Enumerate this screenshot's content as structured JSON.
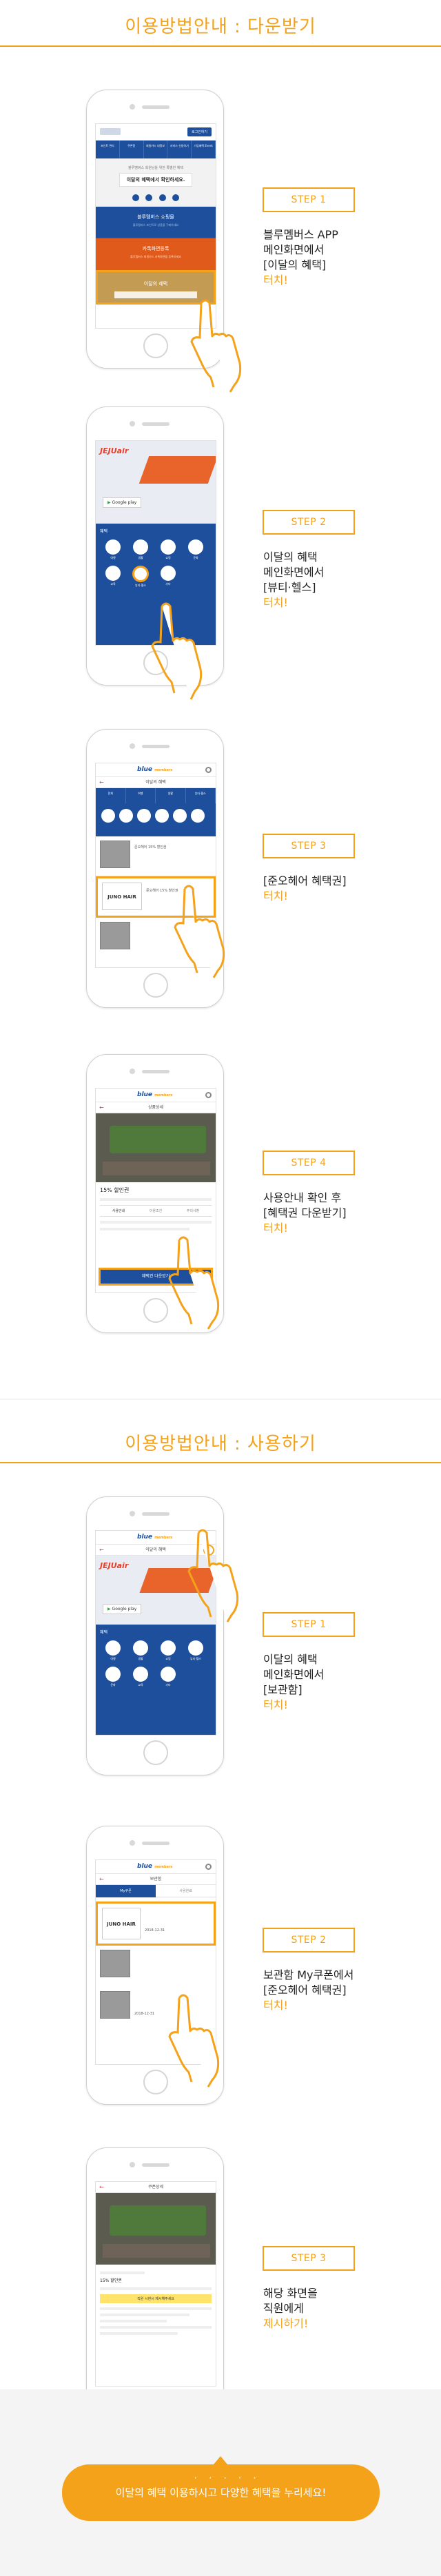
{
  "section1": {
    "title": "이용방법안내 : 다운받기"
  },
  "section2": {
    "title": "이용방법안내 : 사용하기"
  },
  "steps_download": [
    {
      "label": "STEP 1",
      "lines": [
        "블루멤버스 APP",
        "메인화면에서",
        "[이달의 혜택]"
      ],
      "touch": "터치!"
    },
    {
      "label": "STEP 2",
      "lines": [
        "이달의 혜택",
        "메인화면에서",
        "[뷰티·헬스]"
      ],
      "touch": "터치!"
    },
    {
      "label": "STEP 3",
      "lines": [
        "[준오헤어 혜택권]"
      ],
      "touch": "터치!"
    },
    {
      "label": "STEP 4",
      "lines": [
        "사용안내 확인 후",
        "[혜택권 다운받기]"
      ],
      "touch": "터치!"
    }
  ],
  "steps_use": [
    {
      "label": "STEP 1",
      "lines": [
        "이달의 혜택",
        "메인화면에서",
        "[보관함]"
      ],
      "touch": "터치!"
    },
    {
      "label": "STEP 2",
      "lines": [
        "보관함 My쿠폰에서",
        "[준오헤어 혜택권]"
      ],
      "touch": "터치!"
    },
    {
      "label": "STEP 3",
      "lines": [
        "해당 화면을",
        "직원에게"
      ],
      "touch": "제시하기!"
    }
  ],
  "screens": {
    "main": {
      "header_button": "로그인하기",
      "nav": [
        "포인트\n관리",
        "쿠폰함",
        "회원카드\n내정보",
        "서비스\n신청하기",
        "가입혜택\nEvent"
      ],
      "promo_text": "블루멤버스 회원님을 위한 특별한 혜택",
      "promo_title": "이달의 혜택에서 확인하세요.",
      "menu1_title": "블루멤버스 쇼핑몰",
      "menu1_sub": "블루멤버스 포인트로 상품을 구매하세요",
      "menu2_title": "카톡화면등록",
      "menu2_sub": "블루멤버스 회원카드 카톡화면을 등록하세요",
      "menu3_title": "이달의 혜택"
    },
    "benefit": {
      "brand": "JEJUair",
      "google_play": "Google play",
      "category_header": "혜택",
      "categories": [
        "여행",
        "생활",
        "쇼핑",
        "뷰티·헬스",
        "문화",
        "교육",
        "기타"
      ]
    },
    "list": {
      "logo": "blue",
      "logo_sub": "members",
      "title": "이달의 혜택",
      "tabs": [
        "전체",
        "여행",
        "생활",
        "뷰티·헬스"
      ],
      "item1": "준오헤어 15% 할인권",
      "item2_brand": "JUNO HAIR",
      "item2": "준오헤어 15% 할인권"
    },
    "detail": {
      "title": "상품상세",
      "discount": "15% 할인권",
      "tabs": [
        "사용안내",
        "이용조건",
        "주의사항"
      ],
      "download_button": "혜택권 다운받기"
    },
    "storage": {
      "title": "보관함",
      "tabs": [
        "My쿠폰",
        "사용완료"
      ],
      "brand": "JUNO HAIR",
      "date1": "2018-12-31",
      "date2": "2018-12-31"
    },
    "show": {
      "title": "쿠폰상세",
      "discount": "15% 할인권",
      "notice": "직원 시현시 제시해주세요"
    }
  },
  "banner": {
    "text": "이달의 혜택 이용하시고 다양한 혜택을 누리세요!"
  },
  "colors": {
    "accent": "#f5a21b",
    "brand_blue": "#1d4f9c"
  }
}
